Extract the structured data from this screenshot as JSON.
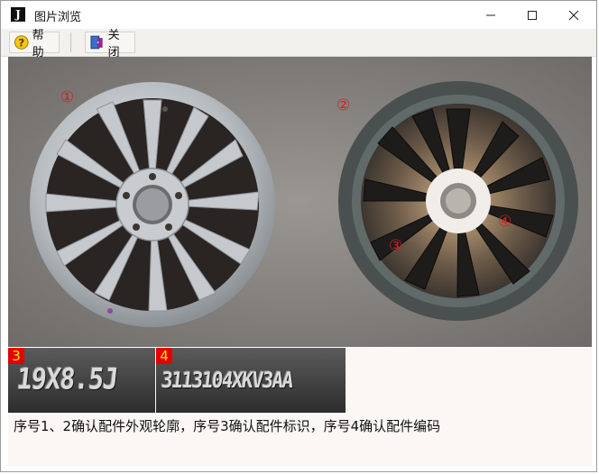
{
  "window": {
    "title": "图片浏览",
    "app_icon_glyph": "J",
    "controls": {
      "minimize": "minimize-icon",
      "maximize": "maximize-icon",
      "close": "close-icon"
    }
  },
  "toolbar": {
    "help_label": "帮助",
    "help_icon": "help-icon",
    "close_label": "关闭",
    "close_icon": "exit-door-icon"
  },
  "viewer": {
    "markers": [
      "①",
      "②",
      "③",
      "④"
    ]
  },
  "crops": [
    {
      "number": "3",
      "text": "19X8.5J"
    },
    {
      "number": "4",
      "text": "3113104XKV3AA"
    }
  ],
  "caption": "序号1、2确认配件外观轮廓，序号3确认配件标识，序号4确认配件编码",
  "colors": {
    "crop_badge_bg": "#e30000",
    "crop_badge_text": "#ffeb00",
    "marker_color": "#d42020"
  }
}
